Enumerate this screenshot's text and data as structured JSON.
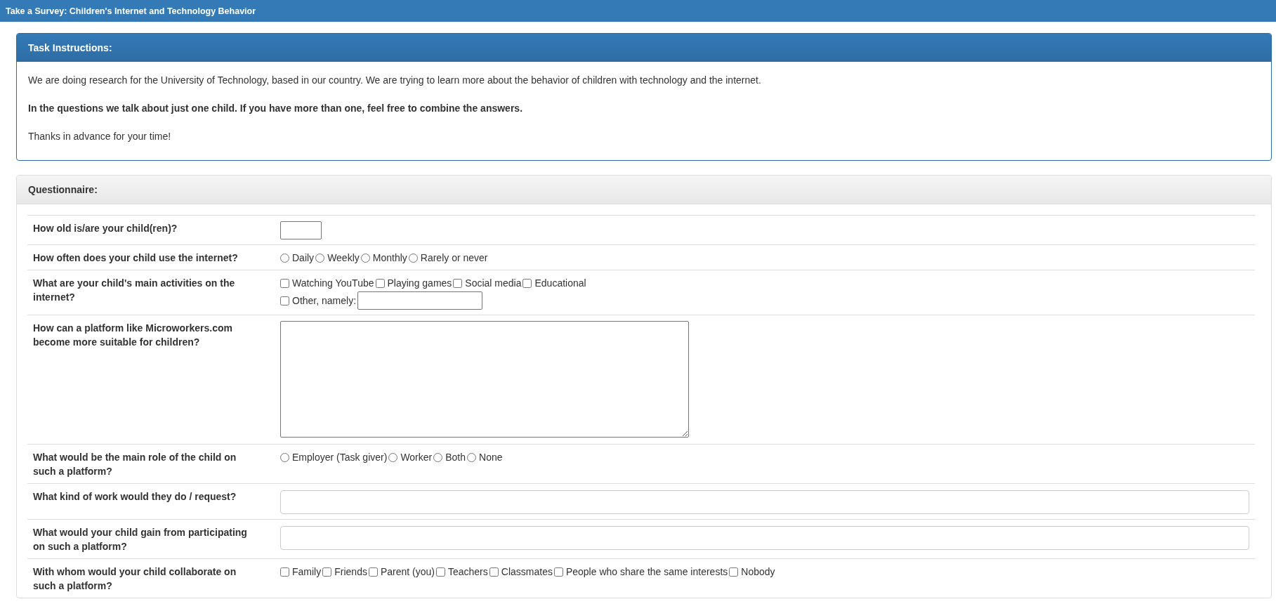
{
  "top_bar": {
    "title": "Take a Survey: Children's Internet and Technology Behavior"
  },
  "instructions": {
    "heading": "Task Instructions:",
    "paragraphs": [
      {
        "text": "We are doing research for the University of Technology, based in our country. We are trying to learn more about the behavior of children with technology and the internet.",
        "bold": false
      },
      {
        "text": "In the questions we talk about just one child. If you have more than one, feel free to combine the answers.",
        "bold": true
      },
      {
        "text": "Thanks in advance for your time!",
        "bold": false
      }
    ]
  },
  "questionnaire": {
    "heading": "Questionnaire:",
    "questions": [
      {
        "kind": "short",
        "label": "How old is/are your child(ren)?"
      },
      {
        "kind": "radio",
        "label": "How often does your child use the internet?",
        "options": [
          {
            "label": "Daily",
            "selected": false
          },
          {
            "label": "Weekly",
            "selected": false
          },
          {
            "label": "Monthly",
            "selected": false
          },
          {
            "label": "Rarely or never",
            "selected": false
          }
        ]
      },
      {
        "kind": "checkbox",
        "label": "What are your child's main activities on the internet?",
        "options": [
          {
            "label": "Watching YouTube",
            "checked": false
          },
          {
            "label": "Playing games",
            "checked": false
          },
          {
            "label": "Social media",
            "checked": false
          },
          {
            "label": "Educational",
            "checked": false
          }
        ],
        "other": {
          "label": "Other, namely:",
          "checked": false
        }
      },
      {
        "kind": "textarea",
        "label": "How can a platform like Microworkers.com become more suitable for children?"
      },
      {
        "kind": "radio",
        "label": "What would be the main role of the child on such a platform?",
        "options": [
          {
            "label": "Employer (Task giver)",
            "selected": false
          },
          {
            "label": "Worker",
            "selected": false
          },
          {
            "label": "Both",
            "selected": false
          },
          {
            "label": "None",
            "selected": false
          }
        ]
      },
      {
        "kind": "wide",
        "label": "What kind of work would they do / request?"
      },
      {
        "kind": "wide",
        "label": "What would your child gain from participating on such a platform?"
      },
      {
        "kind": "checkbox",
        "label": "With whom would your child collaborate on such a platform?",
        "options": [
          {
            "label": "Family",
            "checked": false
          },
          {
            "label": "Friends",
            "checked": false
          },
          {
            "label": "Parent (you)",
            "checked": false
          },
          {
            "label": "Teachers",
            "checked": false
          },
          {
            "label": "Classmates",
            "checked": false
          },
          {
            "label": "People who share the same interests",
            "checked": false
          },
          {
            "label": "Nobody",
            "checked": false
          }
        ]
      }
    ]
  }
}
